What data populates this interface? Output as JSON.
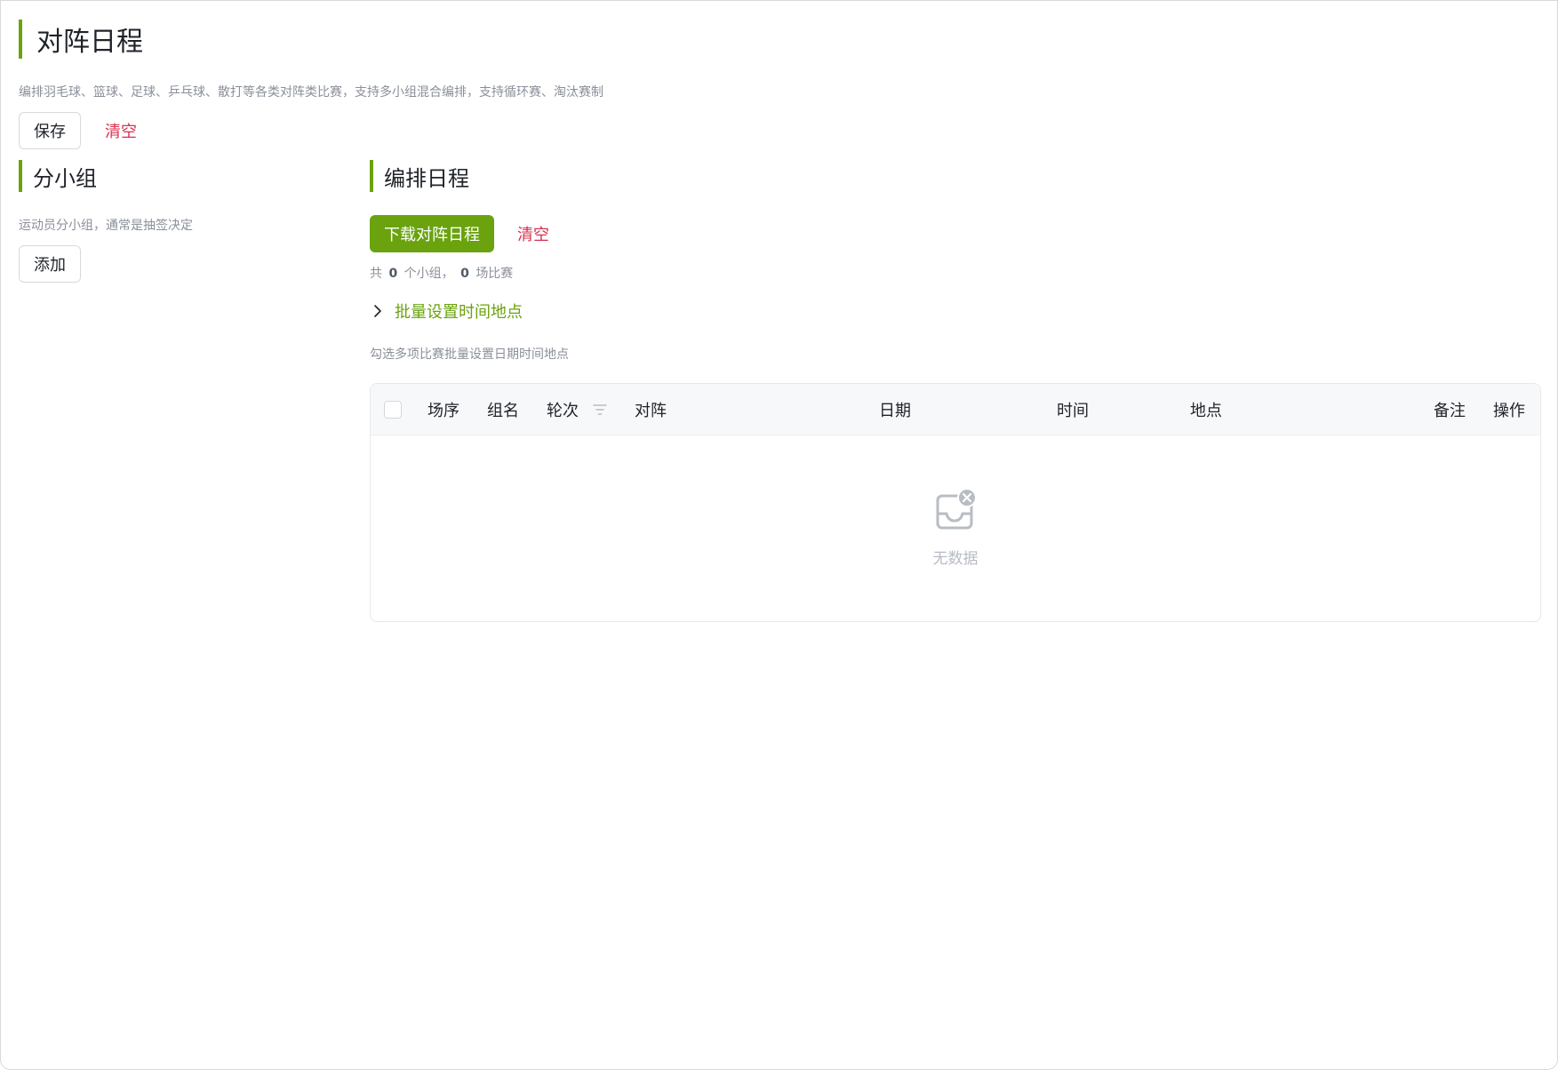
{
  "page": {
    "title": "对阵日程",
    "description": "编排羽毛球、篮球、足球、乒乓球、散打等各类对阵类比赛，支持多小组混合编排，支持循环赛、淘汰赛制",
    "save_label": "保存",
    "clear_label": "清空"
  },
  "groups": {
    "title": "分小组",
    "description": "运动员分小组，通常是抽签决定",
    "add_label": "添加"
  },
  "schedule": {
    "title": "编排日程",
    "download_label": "下载对阵日程",
    "clear_label": "清空",
    "summary_prefix": "共",
    "group_count": "0",
    "summary_mid": "个小组，",
    "match_count": "0",
    "summary_suffix": "场比赛",
    "batch_label": "批量设置时间地点",
    "batch_hint": "勾选多项比赛批量设置日期时间地点",
    "columns": [
      "场序",
      "组名",
      "轮次",
      "对阵",
      "日期",
      "时间",
      "地点",
      "备注",
      "操作"
    ],
    "rows": [],
    "empty_text": "无数据"
  },
  "colors": {
    "accent": "#6aa30e",
    "danger": "#d9304f",
    "muted": "#8a8f99"
  },
  "icons": {
    "batch_toggle": "chevron-right-icon",
    "column_filter": "filter-icon",
    "empty_state": "empty-inbox-icon"
  }
}
